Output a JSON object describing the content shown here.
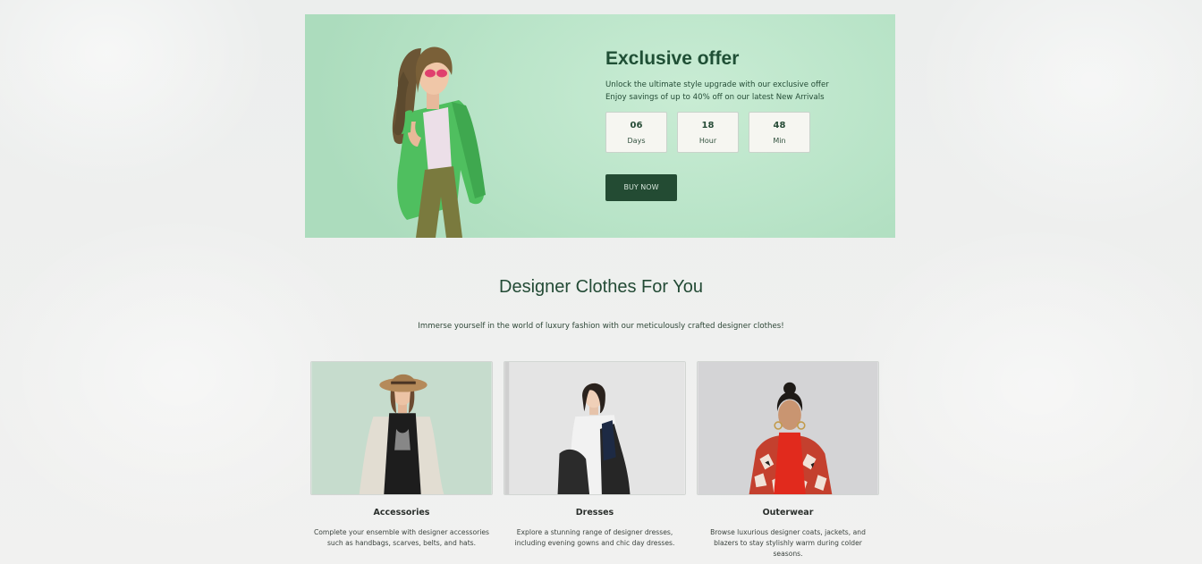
{
  "offer": {
    "title": "Exclusive offer",
    "description": "Unlock the ultimate style upgrade with our exclusive offer Enjoy savings of up to 40% off on our latest New Arrivals",
    "countdown": [
      {
        "value": "06",
        "label": "Days"
      },
      {
        "value": "18",
        "label": "Hour"
      },
      {
        "value": "48",
        "label": "Min"
      }
    ],
    "button_label": "BUY NOW"
  },
  "designer": {
    "title": "Designer Clothes For You",
    "subtitle": "Immerse yourself in the world of luxury fashion with our meticulously crafted designer clothes!",
    "categories": [
      {
        "title": "Accessories",
        "description": "Complete your ensemble with designer accessories such as handbags, scarves, belts, and hats."
      },
      {
        "title": "Dresses",
        "description": "Explore a stunning range of designer dresses, including evening gowns and chic day dresses."
      },
      {
        "title": "Outerwear",
        "description": "Browse luxurious designer coats, jackets, and blazers to stay stylishly warm during colder seasons."
      }
    ]
  },
  "colors": {
    "accent": "#234b33",
    "banner_bg": "#b9e4c8",
    "heading": "#1f4f35"
  }
}
